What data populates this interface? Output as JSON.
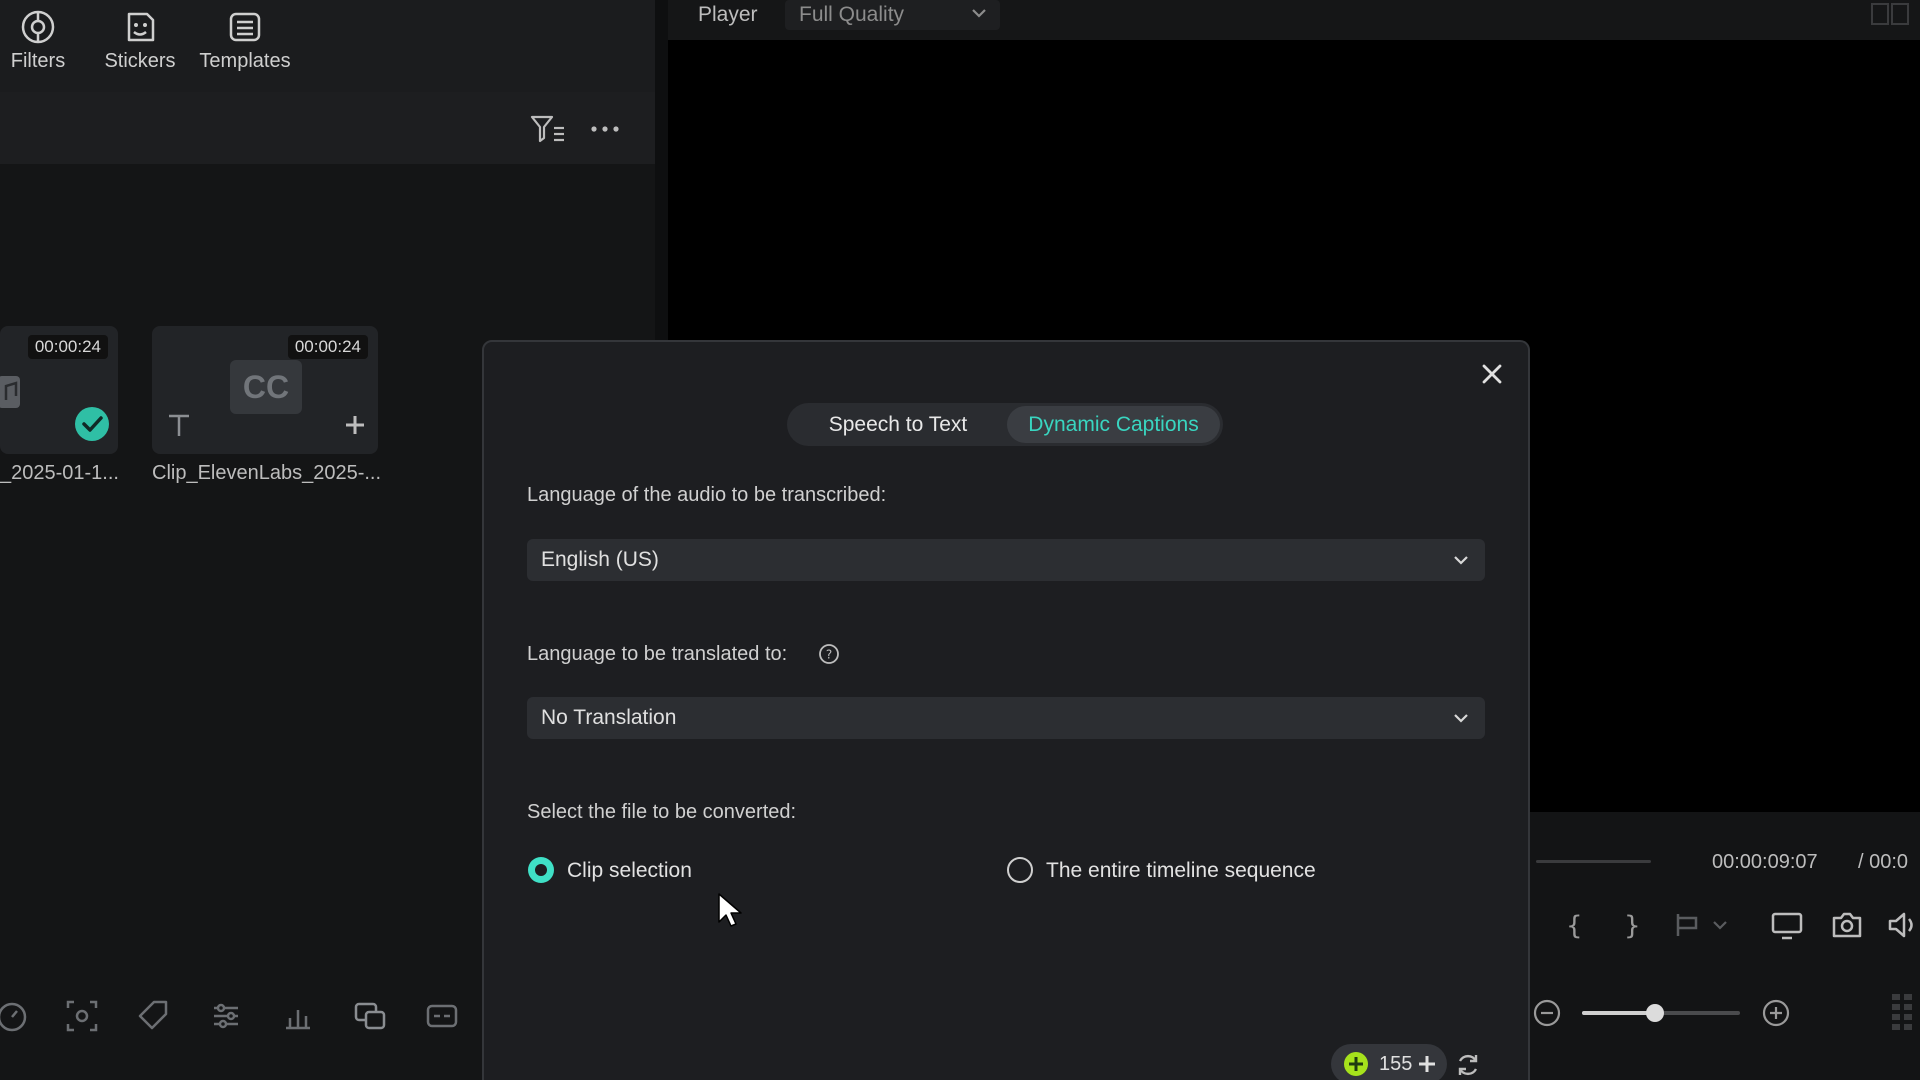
{
  "toolbar": {
    "items": [
      {
        "label": "Filters",
        "icon": "filters-icon"
      },
      {
        "label": "Stickers",
        "icon": "stickers-icon"
      },
      {
        "label": "Templates",
        "icon": "templates-icon"
      }
    ]
  },
  "media": {
    "clips": [
      {
        "duration": "00:00:24",
        "name": "_2025-01-1...",
        "status": "added"
      },
      {
        "duration": "00:00:24",
        "name": "Clip_ElevenLabs_2025-...",
        "type": "caption"
      }
    ],
    "caption_badge": "CC"
  },
  "player": {
    "label": "Player",
    "quality": "Full Quality",
    "current_time": "00:00:09:07",
    "total_time": "/ 00:0"
  },
  "dialog": {
    "tabs": [
      "Speech to Text",
      "Dynamic Captions"
    ],
    "active_tab": "Dynamic Captions",
    "audio_language_label": "Language of the audio to be transcribed:",
    "audio_language_value": "English (US)",
    "translate_label": "Language to be translated to:",
    "translate_value": "No Translation",
    "file_label": "Select the file to be converted:",
    "options": [
      {
        "label": "Clip selection",
        "selected": true
      },
      {
        "label": "The entire timeline sequence",
        "selected": false
      }
    ],
    "credits": "155"
  },
  "colors": {
    "accent": "#3fe0c6",
    "dialog_bg": "#1d1e21",
    "panel_bg": "#151617"
  }
}
